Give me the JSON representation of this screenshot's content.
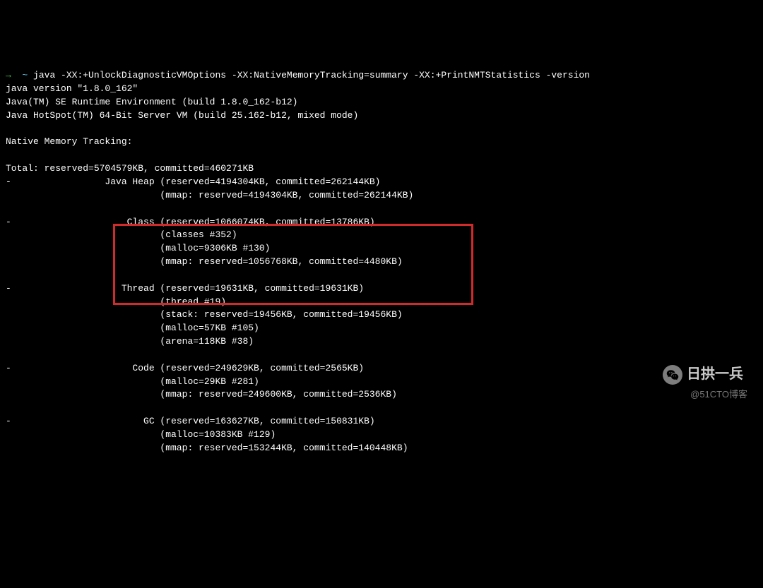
{
  "prompt": {
    "arrow": "→",
    "tilde": "~",
    "command": "java -XX:+UnlockDiagnosticVMOptions -XX:NativeMemoryTracking=summary -XX:+PrintNMTStatistics -version"
  },
  "output": {
    "l1": "java version \"1.8.0_162\"",
    "l2": "Java(TM) SE Runtime Environment (build 1.8.0_162-b12)",
    "l3": "Java HotSpot(TM) 64-Bit Server VM (build 25.162-b12, mixed mode)",
    "l4": "",
    "l5": "Native Memory Tracking:",
    "l6": "",
    "l7": "Total: reserved=5704579KB, committed=460271KB",
    "l8": "-                 Java Heap (reserved=4194304KB, committed=262144KB)",
    "l9": "                            (mmap: reserved=4194304KB, committed=262144KB)",
    "l10": "",
    "l11": "-                     Class (reserved=1066074KB, committed=13786KB)",
    "l12": "                            (classes #352)",
    "l13": "                            (malloc=9306KB #130)",
    "l14": "                            (mmap: reserved=1056768KB, committed=4480KB)",
    "l15": "",
    "l16": "-                    Thread (reserved=19631KB, committed=19631KB)",
    "l17": "                            (thread #19)",
    "l18": "                            (stack: reserved=19456KB, committed=19456KB)",
    "l19": "                            (malloc=57KB #105)",
    "l20": "                            (arena=118KB #38)",
    "l21": "",
    "l22": "-                      Code (reserved=249629KB, committed=2565KB)",
    "l23": "                            (malloc=29KB #281)",
    "l24": "                            (mmap: reserved=249600KB, committed=2536KB)",
    "l25": "",
    "l26": "-                        GC (reserved=163627KB, committed=150831KB)",
    "l27": "                            (malloc=10383KB #129)",
    "l28": "                            (mmap: reserved=153244KB, committed=140448KB)"
  },
  "watermark": {
    "title": "日拱一兵",
    "sub": "@51CTO博客"
  }
}
